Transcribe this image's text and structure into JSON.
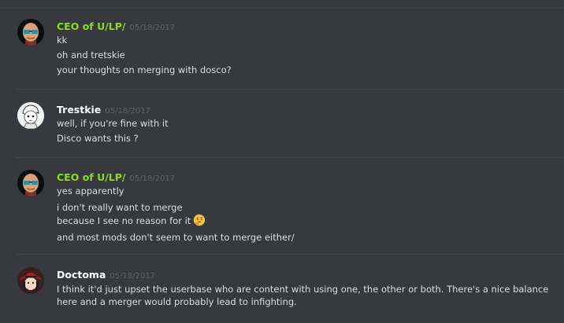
{
  "messages": [
    {
      "author": "CEO of U/LP/",
      "author_color": "#8adc16",
      "timestamp": "05/18/2017",
      "avatar_icon": "bald-sunglasses-avatar",
      "lines": [
        "kk",
        "oh and tretskie",
        "your thoughts on merging with dosco?"
      ]
    },
    {
      "author": "Trestkie",
      "author_color": "#ffffff",
      "timestamp": "05/18/2017",
      "avatar_icon": "anime-sketch-avatar",
      "lines": [
        "well, if you're fine with it",
        "Disco wants this ?"
      ]
    },
    {
      "author": "CEO of U/LP/",
      "author_color": "#8adc16",
      "timestamp": "05/18/2017",
      "avatar_icon": "bald-sunglasses-avatar",
      "lines": [
        "yes apparently",
        "i don't really want to merge",
        "because I see no reason for it",
        "and most mods don't seem to want to merge either/"
      ],
      "emoji": "thinking-face-emoji"
    },
    {
      "author": "Doctoma",
      "author_color": "#ffffff",
      "timestamp": "05/18/2017",
      "avatar_icon": "red-hat-avatar",
      "lines": [
        "I think it'd just upset the userbase who are content with using one, the other or both. There's a nice balance here and a merger would probably lead to infighting."
      ]
    }
  ]
}
